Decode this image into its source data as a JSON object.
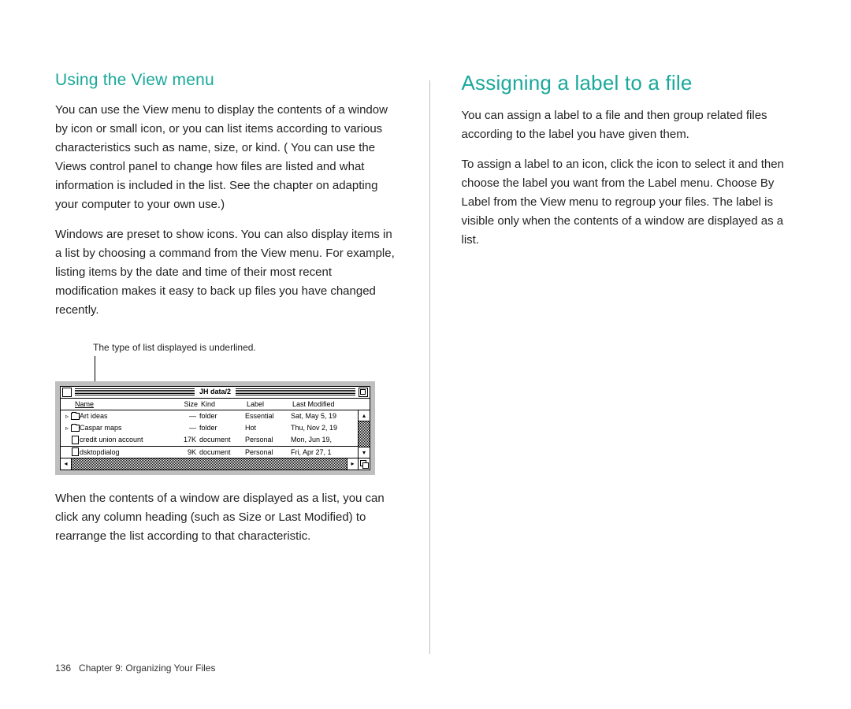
{
  "left": {
    "heading": "Using the View menu",
    "p1": "You can use the View menu to display the contents of a window by icon or small icon, or you can list items according to various characteristics such as name, size, or kind. ( You can use the Views control panel to change how files are listed and what information is included in the list. See the chapter on adapting your computer to your own use.)",
    "p2": "Windows are preset to show icons. You can also display items in a list by choosing a command from the View menu. For example, listing items by the date and time of their most recent modification makes it easy to back up files you have changed recently.",
    "caption": "The type of list displayed is underlined.",
    "window": {
      "title": "JH data/2",
      "headers": [
        "Name",
        "Size",
        "Kind",
        "Label",
        "Last Modified"
      ],
      "rows": [
        {
          "arrow": "▹",
          "icon": "folder",
          "name": "Art ideas",
          "size": "—",
          "kind": "folder",
          "label": "Essential",
          "modified": "Sat, May 5, 19"
        },
        {
          "arrow": "▹",
          "icon": "folder",
          "name": "Caspar maps",
          "size": "—",
          "kind": "folder",
          "label": "Hot",
          "modified": "Thu, Nov 2, 19"
        },
        {
          "arrow": "",
          "icon": "document",
          "name": "credit union account",
          "size": "17K",
          "kind": "document",
          "label": "Personal",
          "modified": "Mon, Jun 19,"
        },
        {
          "arrow": "",
          "icon": "document",
          "name": "dsktopdialog",
          "size": "9K",
          "kind": "document",
          "label": "Personal",
          "modified": "Fri, Apr 27, 1"
        }
      ]
    },
    "p3": "When the contents of a window are displayed as a list, you can click any column heading (such as Size or Last Modified) to rearrange the list according to that characteristic."
  },
  "right": {
    "heading": "Assigning a label to a file",
    "p1": "You can assign a label to a file and then group related files according to the label you have given them.",
    "p2": "To assign a label to an icon, click the icon to select it and then choose the label you want from the Label menu.  Choose By Label from the View menu to regroup your files. The label is visible only when the contents of a window are displayed as a list."
  },
  "footer": {
    "page": "136",
    "chapter": "Chapter 9: Organizing Your Files"
  }
}
